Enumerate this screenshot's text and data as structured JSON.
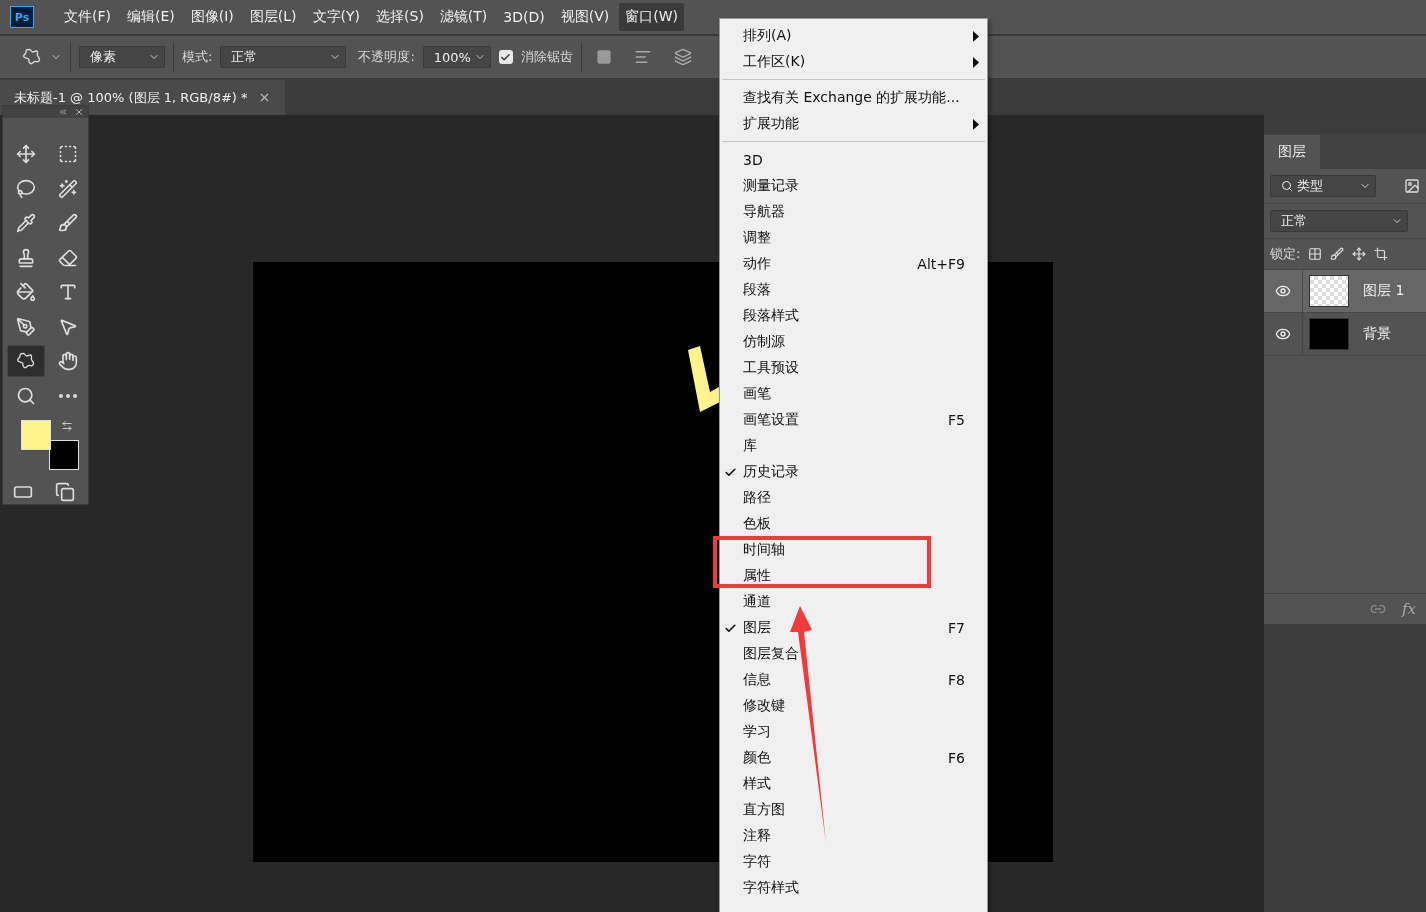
{
  "menubar": {
    "app_badge": "Ps",
    "items": [
      {
        "label": "文件(F)",
        "selected": false
      },
      {
        "label": "编辑(E)",
        "selected": false
      },
      {
        "label": "图像(I)",
        "selected": false
      },
      {
        "label": "图层(L)",
        "selected": false
      },
      {
        "label": "文字(Y)",
        "selected": false
      },
      {
        "label": "选择(S)",
        "selected": false
      },
      {
        "label": "滤镜(T)",
        "selected": false
      },
      {
        "label": "3D(D)",
        "selected": false
      },
      {
        "label": "视图(V)",
        "selected": false
      },
      {
        "label": "窗口(W)",
        "selected": true
      }
    ]
  },
  "options_bar": {
    "mode_select": "像素",
    "mode_label": "模式:",
    "mode_value": "正常",
    "opacity_label": "不透明度:",
    "opacity_value": "100%",
    "antialias": {
      "label": "消除锯齿",
      "checked": true
    }
  },
  "document_tab": {
    "title": "未标题-1 @ 100% (图层 1, RGB/8#) *"
  },
  "toolbox": {
    "tools": [
      {
        "kind": "move",
        "selected": false
      },
      {
        "kind": "marquee",
        "selected": false
      },
      {
        "kind": "lasso",
        "selected": false
      },
      {
        "kind": "wand",
        "selected": false
      },
      {
        "kind": "eyedropper",
        "selected": false
      },
      {
        "kind": "brush",
        "selected": false
      },
      {
        "kind": "stamp",
        "selected": false
      },
      {
        "kind": "eraser",
        "selected": false
      },
      {
        "kind": "bucket",
        "selected": false
      },
      {
        "kind": "type",
        "selected": false
      },
      {
        "kind": "pen",
        "selected": false
      },
      {
        "kind": "pointer",
        "selected": false
      },
      {
        "kind": "shape",
        "selected": true
      },
      {
        "kind": "hand",
        "selected": false
      },
      {
        "kind": "zoom",
        "selected": false
      },
      {
        "kind": "more",
        "selected": false
      }
    ],
    "swatches": [
      {
        "kind": "background",
        "color": "#000000"
      },
      {
        "kind": "foreground",
        "color": "#fff48c"
      }
    ]
  },
  "window_menu": {
    "items": [
      {
        "kind": "item",
        "label": "排列(A)",
        "submenu": true,
        "checked": false
      },
      {
        "kind": "item",
        "label": "工作区(K)",
        "submenu": true,
        "checked": false
      },
      {
        "kind": "separator"
      },
      {
        "kind": "item",
        "label": "查找有关 Exchange 的扩展功能...",
        "submenu": false,
        "checked": false
      },
      {
        "kind": "item",
        "label": "扩展功能",
        "submenu": true,
        "checked": false
      },
      {
        "kind": "separator"
      },
      {
        "kind": "item",
        "label": "3D",
        "submenu": false,
        "checked": false
      },
      {
        "kind": "item",
        "label": "测量记录",
        "submenu": false,
        "checked": false
      },
      {
        "kind": "item",
        "label": "导航器",
        "submenu": false,
        "checked": false
      },
      {
        "kind": "item",
        "label": "调整",
        "submenu": false,
        "checked": false
      },
      {
        "kind": "item",
        "label": "动作",
        "shortcut": "Alt+F9",
        "submenu": false,
        "checked": false
      },
      {
        "kind": "item",
        "label": "段落",
        "submenu": false,
        "checked": false
      },
      {
        "kind": "item",
        "label": "段落样式",
        "submenu": false,
        "checked": false
      },
      {
        "kind": "item",
        "label": "仿制源",
        "submenu": false,
        "checked": false
      },
      {
        "kind": "item",
        "label": "工具预设",
        "submenu": false,
        "checked": false
      },
      {
        "kind": "item",
        "label": "画笔",
        "submenu": false,
        "checked": false
      },
      {
        "kind": "item",
        "label": "画笔设置",
        "shortcut": "F5",
        "submenu": false,
        "checked": false
      },
      {
        "kind": "item",
        "label": "库",
        "submenu": false,
        "checked": false
      },
      {
        "kind": "item",
        "label": "历史记录",
        "submenu": false,
        "checked": true
      },
      {
        "kind": "item",
        "label": "路径",
        "submenu": false,
        "checked": false
      },
      {
        "kind": "item",
        "label": "色板",
        "submenu": false,
        "checked": false
      },
      {
        "kind": "item",
        "label": "时间轴",
        "submenu": false,
        "checked": false
      },
      {
        "kind": "item",
        "label": "属性",
        "submenu": false,
        "checked": false
      },
      {
        "kind": "item",
        "label": "通道",
        "submenu": false,
        "checked": false
      },
      {
        "kind": "item",
        "label": "图层",
        "shortcut": "F7",
        "submenu": false,
        "checked": true
      },
      {
        "kind": "item",
        "label": "图层复合",
        "submenu": false,
        "checked": false
      },
      {
        "kind": "item",
        "label": "信息",
        "shortcut": "F8",
        "submenu": false,
        "checked": false
      },
      {
        "kind": "item",
        "label": "修改键",
        "submenu": false,
        "checked": false
      },
      {
        "kind": "item",
        "label": "学习",
        "submenu": false,
        "checked": false
      },
      {
        "kind": "item",
        "label": "颜色",
        "shortcut": "F6",
        "submenu": false,
        "checked": false
      },
      {
        "kind": "item",
        "label": "样式",
        "submenu": false,
        "checked": false
      },
      {
        "kind": "item",
        "label": "直方图",
        "submenu": false,
        "checked": false
      },
      {
        "kind": "item",
        "label": "注释",
        "submenu": false,
        "checked": false
      },
      {
        "kind": "item",
        "label": "字符",
        "submenu": false,
        "checked": false
      },
      {
        "kind": "item",
        "label": "字符样式",
        "submenu": false,
        "checked": false
      }
    ]
  },
  "layers_panel": {
    "tab": "图层",
    "filter": "类型",
    "blend_mode": "正常",
    "lock_label": "锁定:",
    "layers": [
      {
        "name": "图层 1",
        "selected": true,
        "visible": true,
        "kind": "transparent"
      },
      {
        "name": "背景",
        "selected": false,
        "visible": true,
        "kind": "black"
      }
    ],
    "footer_label": "fx"
  }
}
